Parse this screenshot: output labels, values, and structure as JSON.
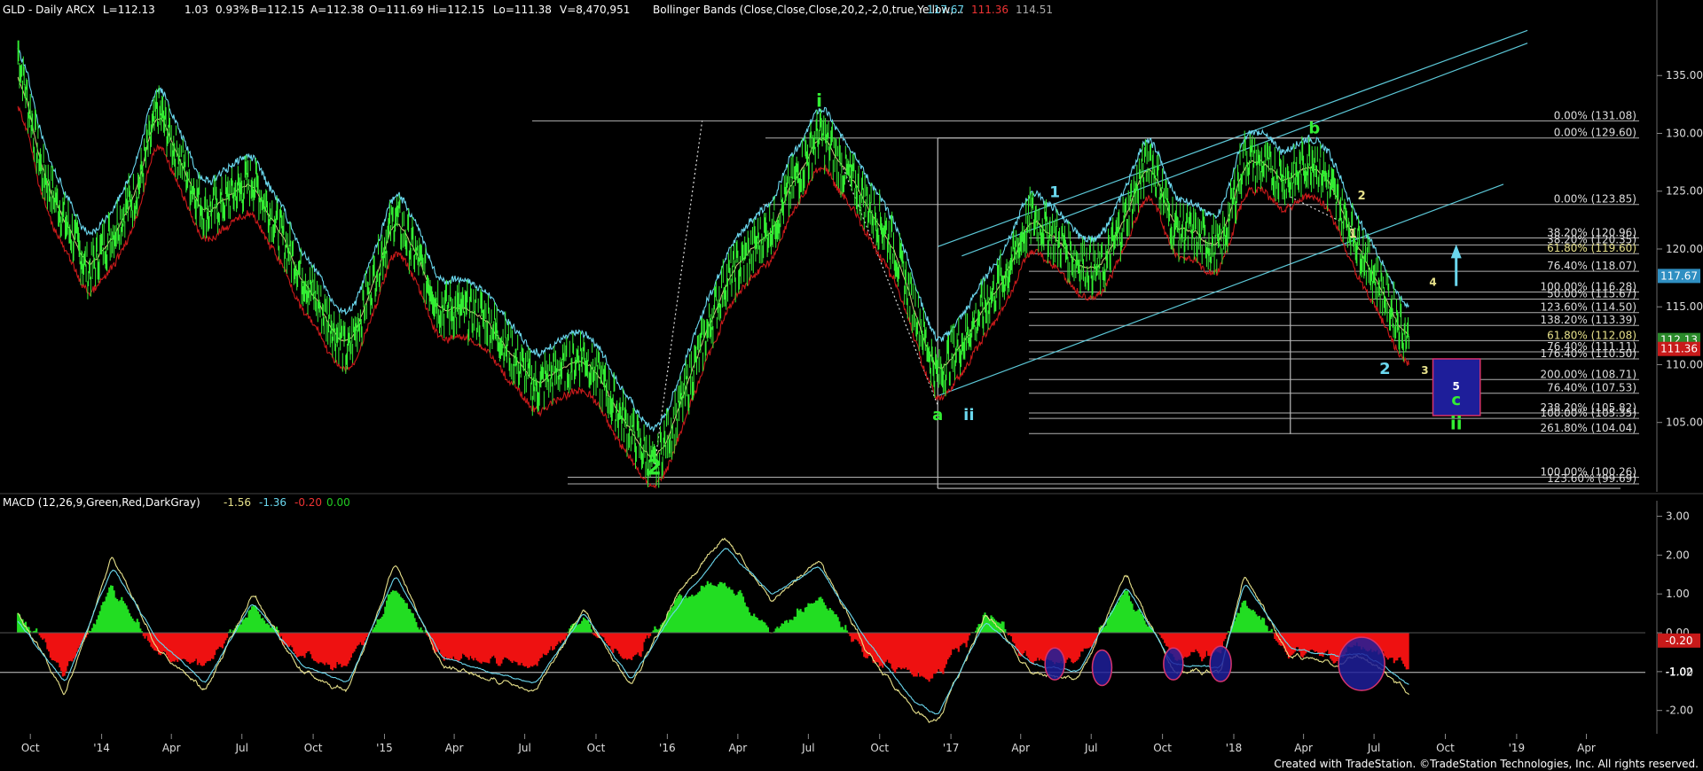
{
  "header": {
    "symbol": "GLD - Daily ARCX",
    "last": "L=112.13",
    "change": "1.03",
    "change_pct": "0.93%",
    "bid": "B=112.15",
    "ask": "A=112.38",
    "open": "O=111.69",
    "high": "Hi=112.15",
    "low": "Lo=111.38",
    "volume": "V=8,470,951",
    "indicator": "Bollinger Bands (Close,Close,Close,20,2,-2,0,true,Yellow,...",
    "bb_upper": "117.67",
    "bb_lower": "111.36",
    "bb_mid": "114.51"
  },
  "macd_header": {
    "label": "MACD (12,26,9,Green,Red,DarkGray)",
    "macd": "-1.56",
    "signal": "-1.36",
    "hist": "-0.20",
    "zero": "0.00"
  },
  "footer": {
    "credit": "Created with TradeStation. ©TradeStation Technologies, Inc. All rights reserved."
  },
  "colors": {
    "background": "#000000",
    "price": "#33ee33",
    "bb_upper": "#6ad7ee",
    "bb_mid": "#e6e08a",
    "bb_lower": "#c81a1a",
    "fib": "#dcdcdc",
    "channel": "#5cc8d8",
    "target_box": "#1e1e9a",
    "target_border": "#d6336c",
    "macd_line": "#6ad7ee",
    "signal_line": "#e6e08a",
    "hist_pos": "#22dd22",
    "hist_neg": "#ee1111"
  },
  "chart_data": [
    {
      "type": "line",
      "name": "price",
      "y_axis_ticks": [
        "135.00",
        "130.00",
        "125.00",
        "120.00",
        "115.00",
        "110.00",
        "105.00"
      ],
      "ylim": [
        99,
        140
      ],
      "x_tick_labels": [
        "Oct",
        "'14",
        "Apr",
        "Jul",
        "Oct",
        "'15",
        "Apr",
        "Jul",
        "Oct",
        "'16",
        "Apr",
        "Jul",
        "Oct",
        "'17",
        "Apr",
        "Jul",
        "Oct",
        "'18",
        "Apr",
        "Jul",
        "Oct",
        "'19",
        "Apr"
      ],
      "series": [
        {
          "name": "GLD close",
          "x": [
            "2013-09",
            "2013-10",
            "2013-12",
            "2014-02",
            "2014-03",
            "2014-05",
            "2014-07",
            "2014-09",
            "2014-11",
            "2015-01",
            "2015-03",
            "2015-05",
            "2015-07",
            "2015-09",
            "2015-12",
            "2016-01",
            "2016-03",
            "2016-05",
            "2016-07",
            "2016-08",
            "2016-10",
            "2016-12",
            "2017-01",
            "2017-03",
            "2017-04",
            "2017-06",
            "2017-07",
            "2017-09",
            "2017-10",
            "2017-12",
            "2018-01",
            "2018-03",
            "2018-04",
            "2018-05",
            "2018-06",
            "2018-07",
            "2018-08"
          ],
          "values": [
            137,
            127,
            118,
            125,
            132,
            123,
            126,
            118,
            111,
            123,
            115,
            114,
            108,
            111,
            101,
            106,
            117,
            122,
            130,
            127,
            121,
            109,
            112,
            118,
            123,
            119,
            118,
            128,
            122,
            120,
            128,
            126,
            128,
            124,
            120,
            116,
            112
          ]
        }
      ],
      "bollinger": {
        "upper": 117.67,
        "lower": 111.36,
        "mid": 114.51
      },
      "fib_levels": [
        {
          "label": "0.00% (131.08)",
          "value": 131.08
        },
        {
          "label": "0.00% (129.60)",
          "value": 129.6
        },
        {
          "label": "0.00% (123.85)",
          "value": 123.85
        },
        {
          "label": "38.20% (120.96)",
          "value": 120.96
        },
        {
          "label": "38.20% (120.35)",
          "value": 120.35
        },
        {
          "label": "61.80% (119.60)",
          "value": 119.6
        },
        {
          "label": "76.40% (118.07)",
          "value": 118.07
        },
        {
          "label": "100.00% (116.28)",
          "value": 116.28
        },
        {
          "label": "50.00% (115.67)",
          "value": 115.67
        },
        {
          "label": "123.60% (114.50)",
          "value": 114.5
        },
        {
          "label": "138.20% (113.39)",
          "value": 113.39
        },
        {
          "label": "61.80% (112.08)",
          "value": 112.08
        },
        {
          "label": "76.40% (111.11)",
          "value": 111.11
        },
        {
          "label": "176.40% (110.50)",
          "value": 110.5
        },
        {
          "label": "200.00% (108.71)",
          "value": 108.71
        },
        {
          "label": "76.40% (107.53)",
          "value": 107.53
        },
        {
          "label": "238.20% (105.82)",
          "value": 105.82
        },
        {
          "label": "100.00% (105.35)",
          "value": 105.35
        },
        {
          "label": "261.80% (104.04)",
          "value": 104.04
        },
        {
          "label": "100.00% (100.26)",
          "value": 100.26
        },
        {
          "label": "123.60% (99.69)",
          "value": 99.69
        }
      ],
      "price_tags": [
        {
          "label": "117.67",
          "value": 117.67
        },
        {
          "label": "112.13",
          "value": 112.13
        },
        {
          "label": "111.36",
          "value": 111.36
        }
      ],
      "wave_labels": [
        {
          "text": "i",
          "date": "2016-07",
          "price": 132.3
        },
        {
          "text": "2",
          "date": "2015-12",
          "price": 100.5
        },
        {
          "text": "a",
          "date": "2016-12",
          "price": 105.2
        },
        {
          "text": "ii",
          "date": "2017-01",
          "price": 105.2
        },
        {
          "text": "1",
          "date": "2017-05",
          "price": 124.5
        },
        {
          "text": "b",
          "date": "2018-04",
          "price": 130.0
        },
        {
          "text": "2",
          "date": "2018-06",
          "price": 124.3
        },
        {
          "text": "1",
          "date": "2018-06",
          "price": 121.0
        },
        {
          "text": "4",
          "date": "2018-09",
          "price": 116.8
        },
        {
          "text": "2",
          "date": "2018-07",
          "price": 109.2
        },
        {
          "text": "3",
          "date": "2018-08",
          "price": 109.2
        },
        {
          "text": "5",
          "date": "2018-10",
          "price": 107.8
        },
        {
          "text": "c",
          "date": "2018-10",
          "price": 106.5
        },
        {
          "text": "ii",
          "date": "2018-10",
          "price": 104.4
        }
      ],
      "target_box": {
        "date_start": "2018-09",
        "date_end": "2018-11",
        "high": 110.5,
        "low": 105.6
      }
    },
    {
      "type": "line",
      "name": "macd",
      "y_axis_ticks": [
        "3.00",
        "2.00",
        "1.00",
        "0.00",
        "-1.00",
        "-2.00"
      ],
      "ylim": [
        -2.6,
        3.4
      ],
      "macd_tags": [
        {
          "label": "-0.20",
          "value": -0.2
        },
        {
          "label": "-1.02",
          "value": -1.02
        }
      ],
      "series": [
        {
          "name": "MACD",
          "x": [
            "2013-09",
            "2013-11",
            "2014-01",
            "2014-03",
            "2014-05",
            "2014-07",
            "2014-09",
            "2014-11",
            "2015-01",
            "2015-03",
            "2015-05",
            "2015-07",
            "2015-09",
            "2015-11",
            "2016-01",
            "2016-03",
            "2016-05",
            "2016-07",
            "2016-09",
            "2016-11",
            "2016-12",
            "2017-02",
            "2017-04",
            "2017-06",
            "2017-08",
            "2017-10",
            "2017-12",
            "2018-01",
            "2018-03",
            "2018-05",
            "2018-06",
            "2018-07",
            "2018-08"
          ],
          "values": [
            0.5,
            -1.6,
            2.0,
            -0.5,
            -1.5,
            1.0,
            -1.0,
            -1.5,
            1.8,
            -0.8,
            -1.2,
            -1.5,
            0.6,
            -1.4,
            1.0,
            2.5,
            0.8,
            1.9,
            -0.5,
            -2.0,
            -2.3,
            0.5,
            -1.0,
            -1.2,
            1.5,
            -1.0,
            -1.0,
            1.5,
            -0.6,
            -0.8,
            -0.6,
            -1.0,
            -1.56
          ]
        },
        {
          "name": "Signal",
          "x": [
            "2013-09",
            "2013-11",
            "2014-01",
            "2014-03",
            "2014-05",
            "2014-07",
            "2014-09",
            "2014-11",
            "2015-01",
            "2015-03",
            "2015-05",
            "2015-07",
            "2015-09",
            "2015-11",
            "2016-01",
            "2016-03",
            "2016-05",
            "2016-07",
            "2016-09",
            "2016-11",
            "2016-12",
            "2017-02",
            "2017-04",
            "2017-06",
            "2017-08",
            "2017-10",
            "2017-12",
            "2018-01",
            "2018-03",
            "2018-05",
            "2018-06",
            "2018-07",
            "2018-08"
          ],
          "values": [
            0.3,
            -1.3,
            1.7,
            -0.2,
            -1.3,
            0.8,
            -0.8,
            -1.3,
            1.5,
            -0.6,
            -1.0,
            -1.3,
            0.5,
            -1.2,
            0.7,
            2.2,
            1.0,
            1.7,
            -0.2,
            -1.8,
            -2.1,
            0.3,
            -0.8,
            -1.0,
            1.2,
            -0.8,
            -0.9,
            1.3,
            -0.4,
            -0.6,
            -0.5,
            -0.9,
            -1.36
          ]
        }
      ]
    }
  ]
}
